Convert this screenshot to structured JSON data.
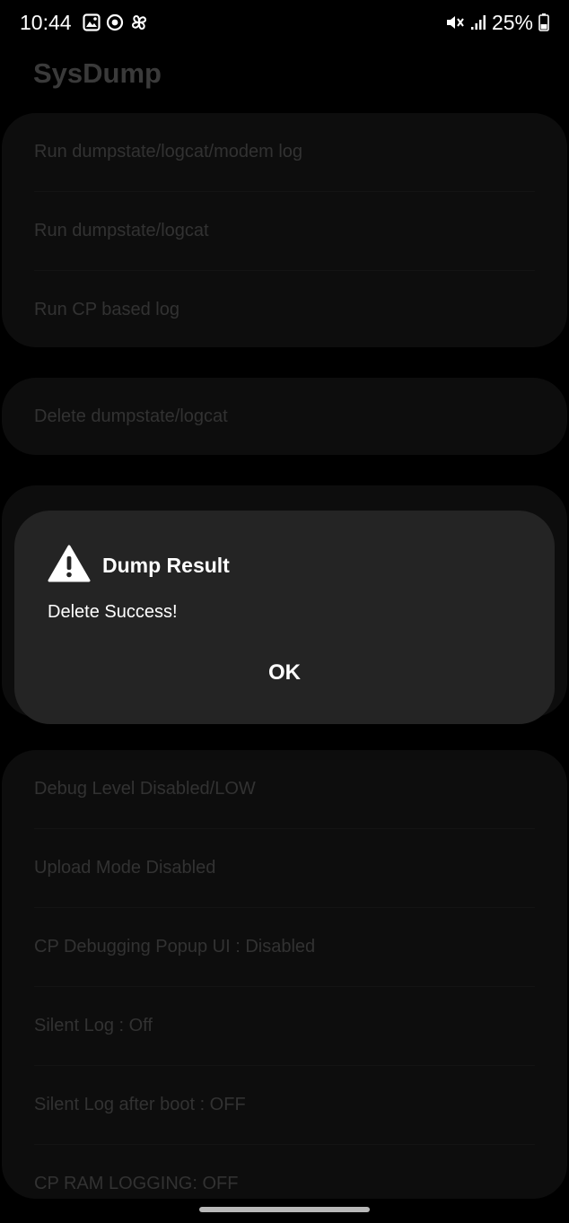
{
  "status_bar": {
    "time": "10:44",
    "battery": "25%",
    "icons_left": [
      "gallery-icon",
      "at-sign-icon",
      "pinwheel-icon"
    ],
    "icons_right": [
      "mute-icon",
      "signal-icon",
      "battery-icon"
    ]
  },
  "app": {
    "title": "SysDump"
  },
  "cards": [
    {
      "items": [
        "Run dumpstate/logcat/modem log",
        "Run dumpstate/logcat",
        "Run CP based log"
      ]
    },
    {
      "items": [
        "Delete dumpstate/logcat"
      ]
    },
    {
      "items": [
        "Debug Level Disabled/LOW",
        "Upload Mode Disabled",
        "CP Debugging Popup UI : Disabled",
        "Silent Log : Off",
        "Silent Log after boot : OFF",
        "CP RAM LOGGING: OFF"
      ]
    }
  ],
  "dialog": {
    "icon": "warning-icon",
    "title": "Dump Result",
    "message": "Delete Success!",
    "ok_label": "OK"
  },
  "colors": {
    "background": "#000000",
    "card": "#151515",
    "dialog": "#242424",
    "dim_text": "#4d4d4d"
  }
}
